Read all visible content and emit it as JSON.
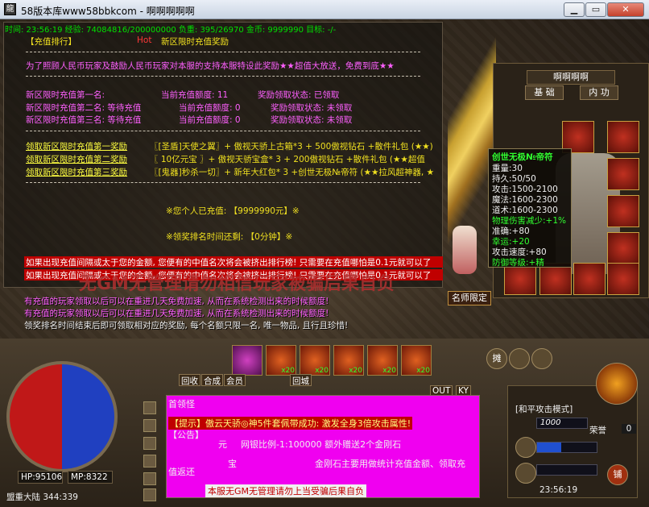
{
  "window": {
    "title": "58版本库www58bbkcom - 啊啊啊啊啊",
    "min_label": "▁",
    "max_label": "▭",
    "close_label": "✕"
  },
  "status_line": "时间: 23:56:19 经验: 74084816/200000000 负重: 395/26970 金币: 9999990 目标: -/-",
  "panel": {
    "header_left": "【充值排行】",
    "header_hot": "Hot",
    "header_title": "新区限时充值奖励",
    "intro": "为了照顾人民币玩家及鼓励人民币玩家对本服的支持本服特设此奖励★★超值大放送，免费到底★★",
    "ranks": [
      {
        "name": "新区限时充值第一名:",
        "amount_label": "当前充值额度: 11",
        "status_label": "奖励领取状态: 已领取"
      },
      {
        "name": "新区限时充值第二名: 等待充值",
        "amount_label": "当前充值额度: 0",
        "status_label": "奖励领取状态: 未领取"
      },
      {
        "name": "新区限时充值第三名: 等待充值",
        "amount_label": "当前充值额度: 0",
        "status_label": "奖励领取状态: 未领取"
      }
    ],
    "claims": [
      {
        "link": "领取新区限时充值第一奖励",
        "reward": "〖[圣盾]天使之翼〗+ 傲视天骄上古箱*3 + 500傲视钻石 +散件礼包 (★★)"
      },
      {
        "link": "领取新区限时充值第二奖励",
        "reward": "〖  10亿元宝  〗+ 傲视天骄宝盒* 3 + 200傲视钻石 +散件礼包 (★★超值"
      },
      {
        "link": "领取新区限时充值第三奖励",
        "reward": "〖[鬼器]秒杀一切〗+ 新年大红包* 3 +创世无极№帝符 (★★拉风超神器, ★"
      }
    ],
    "personal": "※您个人已充值: 【9999990元】※",
    "time_left": "※领奖排名时间还剩: 【0分钟】※",
    "warning1": "如果出现充值间隔或太于您的金额, 您便有的中值名次将会被挤出排行榜! 只需要在充值哪怕是0.1元就可以了",
    "warning2": "如果出现充值间隔或太于您的金额, 您便有的中值名次将会被挤出排行榜! 只需要在充值哪怕是0.1元就可以了",
    "big_watermark": "无GM无管理请勿相信玩家被骗后果自负"
  },
  "notices": [
    "有充值的玩家领取以后可以在重进几天免费加速, 从而在系统检测出来的时候额度!",
    "有充值的玩家领取以后可以在重进几天免费加速, 从而在系统检测出来的时候额度!",
    "领奖排名时间结束后即可领取相对应的奖励, 每个名额只限一名, 唯一物品, 且行且珍惜!"
  ],
  "character": {
    "name": "啊啊啊啊",
    "tab_basic": "基 础",
    "tab_inner": "内 功",
    "tooltip": {
      "title": "创世无极№帝符",
      "lines": [
        "重量:30",
        "持久:50/50",
        "攻击:1500-2100",
        "魔法:1600-2300",
        "道术:1600-2300",
        "物理伤害减少:+1%",
        "准确:+80",
        "幸运:+20",
        "攻击速度:+80",
        "防御等级:+精"
      ]
    }
  },
  "npc_button": "名师限定",
  "hp_label": "HP:95106",
  "mp_label": "MP:8322",
  "map_label": "盟重大陆 344:339",
  "potions": [
    {
      "count": "x20"
    },
    {
      "count": "x20"
    },
    {
      "count": "x20"
    },
    {
      "count": "x20"
    },
    {
      "count": "x20"
    },
    {
      "count": "x20"
    }
  ],
  "chat_tabs": [
    "回收",
    "合成",
    "会员",
    "回城",
    "OUT",
    "KY"
  ],
  "chat": {
    "line1": "首领怪",
    "line2": "【提示】傲云天骄◎神5件套佩带成功: 激发全身3倍攻击属性!",
    "line3": "【公告】",
    "line4_a": "元",
    "line4_b": "网银比例-1:100000 额外赠送2个金刚石",
    "line5": "宝",
    "line6": "金刚石主要用做统计充值金额、领取充",
    "line7": "值返还",
    "footer": "本服无GM无管理请勿上当受骗后果自负"
  },
  "attack_mode": "[和平攻击模式]",
  "level_value": "1000",
  "honor_label": "荣誉",
  "honor_value": "0",
  "clock": "23:56:19",
  "shop_button": "铺",
  "trade_button": "摊"
}
